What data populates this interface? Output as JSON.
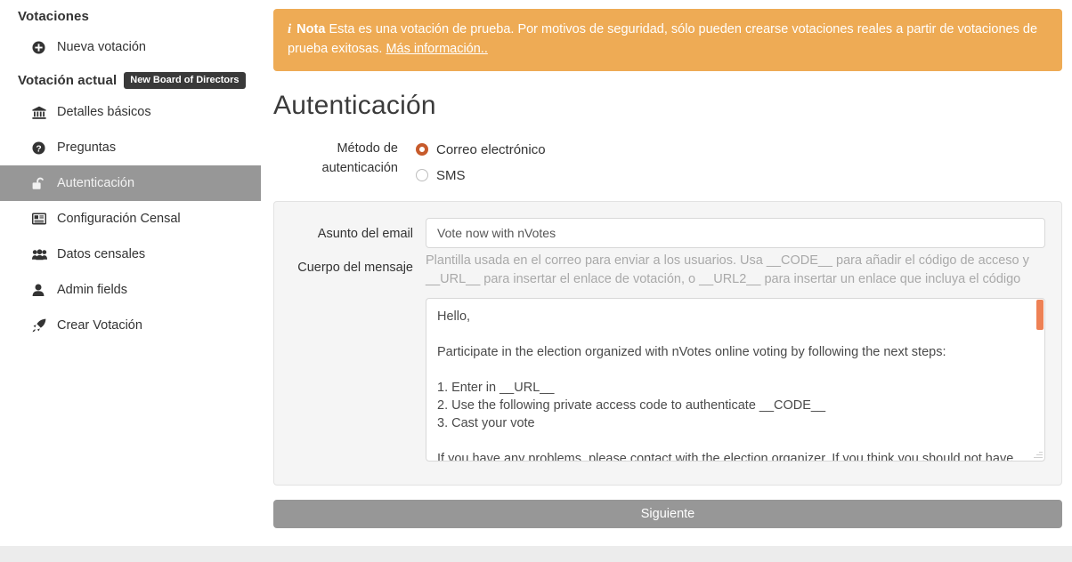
{
  "sidebar": {
    "heading_elections": "Votaciones",
    "new_election": {
      "label": "Nueva votación",
      "icon": "plus-circle-icon"
    },
    "heading_current": "Votación actual",
    "current_badge": "New Board of Directors",
    "items": [
      {
        "label": "Detalles básicos",
        "icon": "bank-icon",
        "active": false
      },
      {
        "label": "Preguntas",
        "icon": "question-circle-icon",
        "active": false
      },
      {
        "label": "Autenticación",
        "icon": "unlock-icon",
        "active": true
      },
      {
        "label": "Configuración Censal",
        "icon": "newspaper-icon",
        "active": false
      },
      {
        "label": "Datos censales",
        "icon": "users-icon",
        "active": false
      },
      {
        "label": "Admin fields",
        "icon": "user-icon",
        "active": false
      },
      {
        "label": "Crear Votación",
        "icon": "rocket-icon",
        "active": false
      }
    ]
  },
  "alert": {
    "icon": "info-icon",
    "icon_glyph": "i",
    "strong": "Nota",
    "text": "Esta es una votación de prueba. Por motivos de seguridad, sólo pueden crearse votaciones reales a partir de votaciones de prueba exitosas.",
    "link": "Más información..",
    "background": "#eeab55"
  },
  "page_title": "Autenticación",
  "auth_method": {
    "label": "Método de autenticación",
    "options": [
      {
        "label": "Correo electrónico",
        "selected": true
      },
      {
        "label": "SMS",
        "selected": false
      }
    ],
    "selected_color": "#c75b2c"
  },
  "email_form": {
    "subject_label": "Asunto del email",
    "subject_value": "Vote now with nVotes",
    "subject_placeholder": "Asunto del email",
    "body_label": "Cuerpo del mensaje",
    "body_help": "Plantilla usada en el correo para enviar a los usuarios. Usa __CODE__ para añadir el código de acceso y __URL__ para insertar el enlace de votación, o __URL2__ para insertar un enlace que incluya el código",
    "body_value": "Hello,\n\nParticipate in the election organized with nVotes online voting by following the next steps:\n\n1. Enter in __URL__\n2. Use the following private access code to authenticate __CODE__\n3. Cast your vote\n\nIf you have any problems, please contact with the election organizer. If you think you should not have",
    "body_placeholder": "Cuerpo del mensaje",
    "scrollbar_color": "#ee8155"
  },
  "next_button": {
    "label": "Siguiente",
    "background": "#979797"
  }
}
